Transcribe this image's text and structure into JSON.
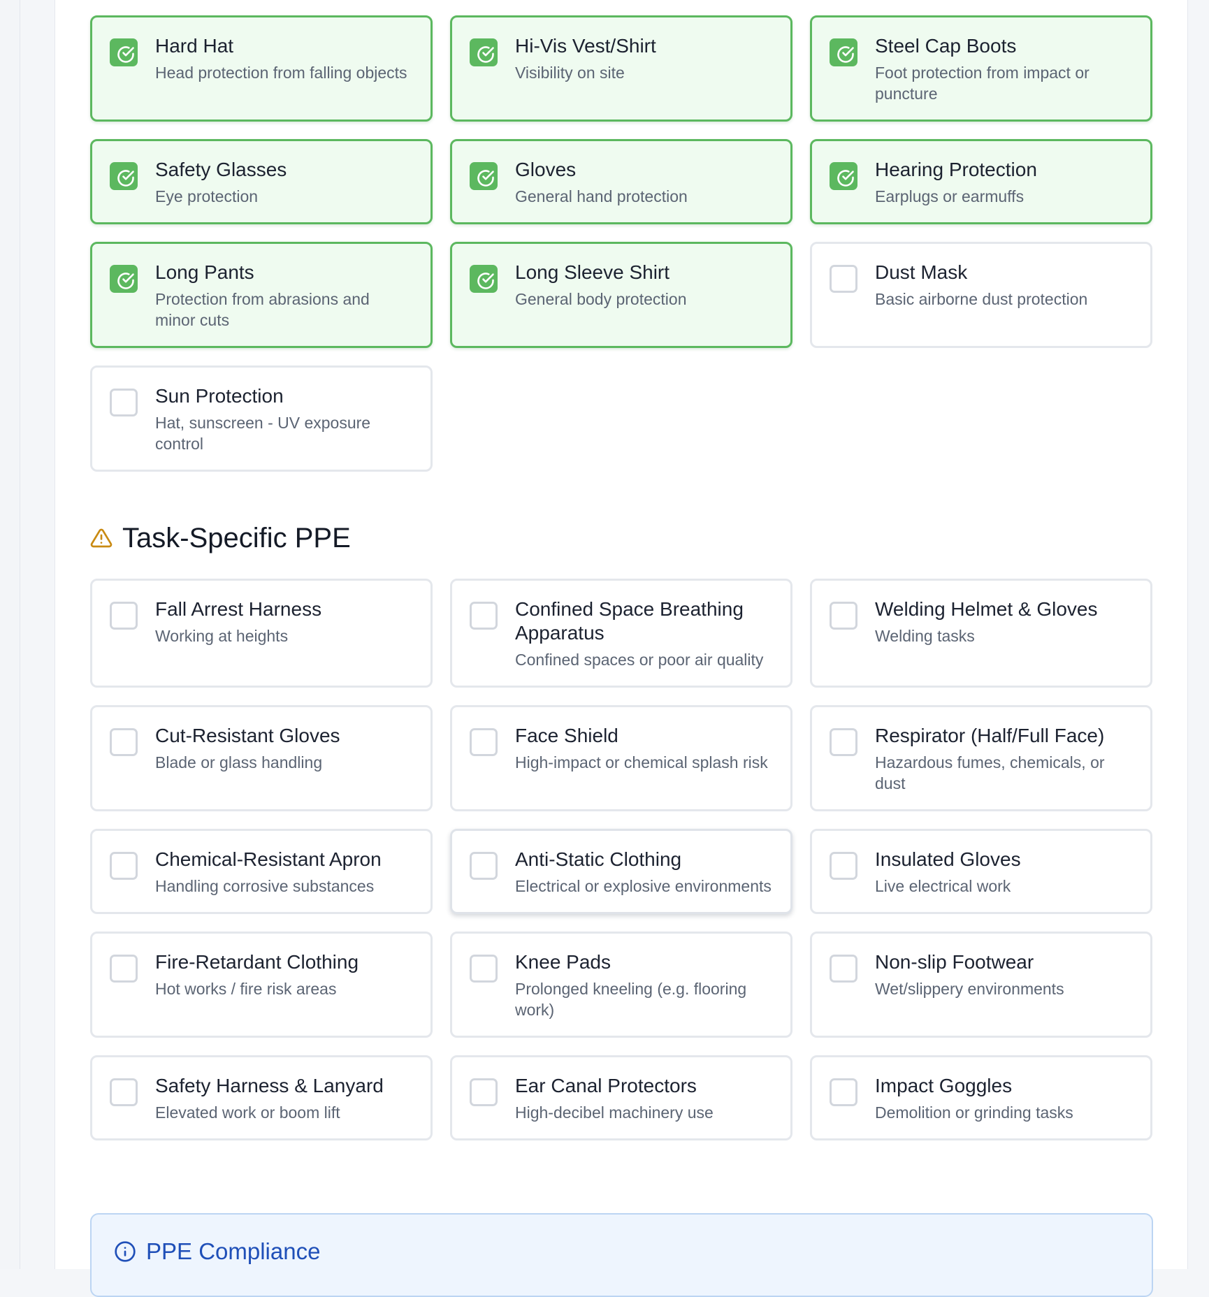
{
  "general_ppe": [
    {
      "title": "Hard Hat",
      "description": "Head protection from falling objects",
      "checked": true
    },
    {
      "title": "Hi-Vis Vest/Shirt",
      "description": "Visibility on site",
      "checked": true
    },
    {
      "title": "Steel Cap Boots",
      "description": "Foot protection from impact or puncture",
      "checked": true
    },
    {
      "title": "Safety Glasses",
      "description": "Eye protection",
      "checked": true
    },
    {
      "title": "Gloves",
      "description": "General hand protection",
      "checked": true
    },
    {
      "title": "Hearing Protection",
      "description": "Earplugs or earmuffs",
      "checked": true
    },
    {
      "title": "Long Pants",
      "description": "Protection from abrasions and minor cuts",
      "checked": true
    },
    {
      "title": "Long Sleeve Shirt",
      "description": "General body protection",
      "checked": true
    },
    {
      "title": "Dust Mask",
      "description": "Basic airborne dust protection",
      "checked": false
    },
    {
      "title": "Sun Protection",
      "description": "Hat, sunscreen - UV exposure control",
      "checked": false
    }
  ],
  "task_section": {
    "title": "Task-Specific PPE",
    "icon": "warning-triangle-icon"
  },
  "task_ppe": [
    {
      "title": "Fall Arrest Harness",
      "description": "Working at heights",
      "checked": false
    },
    {
      "title": "Confined Space Breathing Apparatus",
      "description": "Confined spaces or poor air quality",
      "checked": false
    },
    {
      "title": "Welding Helmet & Gloves",
      "description": "Welding tasks",
      "checked": false
    },
    {
      "title": "Cut-Resistant Gloves",
      "description": "Blade or glass handling",
      "checked": false
    },
    {
      "title": "Face Shield",
      "description": "High-impact or chemical splash risk",
      "checked": false
    },
    {
      "title": "Respirator (Half/Full Face)",
      "description": "Hazardous fumes, chemicals, or dust",
      "checked": false
    },
    {
      "title": "Chemical-Resistant Apron",
      "description": "Handling corrosive substances",
      "checked": false
    },
    {
      "title": "Anti-Static Clothing",
      "description": "Electrical or explosive environments",
      "checked": false,
      "hovered": true
    },
    {
      "title": "Insulated Gloves",
      "description": "Live electrical work",
      "checked": false
    },
    {
      "title": "Fire-Retardant Clothing",
      "description": "Hot works / fire risk areas",
      "checked": false
    },
    {
      "title": "Knee Pads",
      "description": "Prolonged kneeling (e.g. flooring work)",
      "checked": false
    },
    {
      "title": "Non-slip Footwear",
      "description": "Wet/slippery environments",
      "checked": false
    },
    {
      "title": "Safety Harness & Lanyard",
      "description": "Elevated work or boom lift",
      "checked": false
    },
    {
      "title": "Ear Canal Protectors",
      "description": "High-decibel machinery use",
      "checked": false
    },
    {
      "title": "Impact Goggles",
      "description": "Demolition or grinding tasks",
      "checked": false
    }
  ],
  "compliance": {
    "title": "PPE Compliance",
    "icon": "info-circle-icon"
  },
  "colors": {
    "checked_border": "#5cb85f",
    "checked_background": "#effbf0",
    "warning_icon": "#c98a12",
    "info_accent": "#1f4fb8"
  }
}
